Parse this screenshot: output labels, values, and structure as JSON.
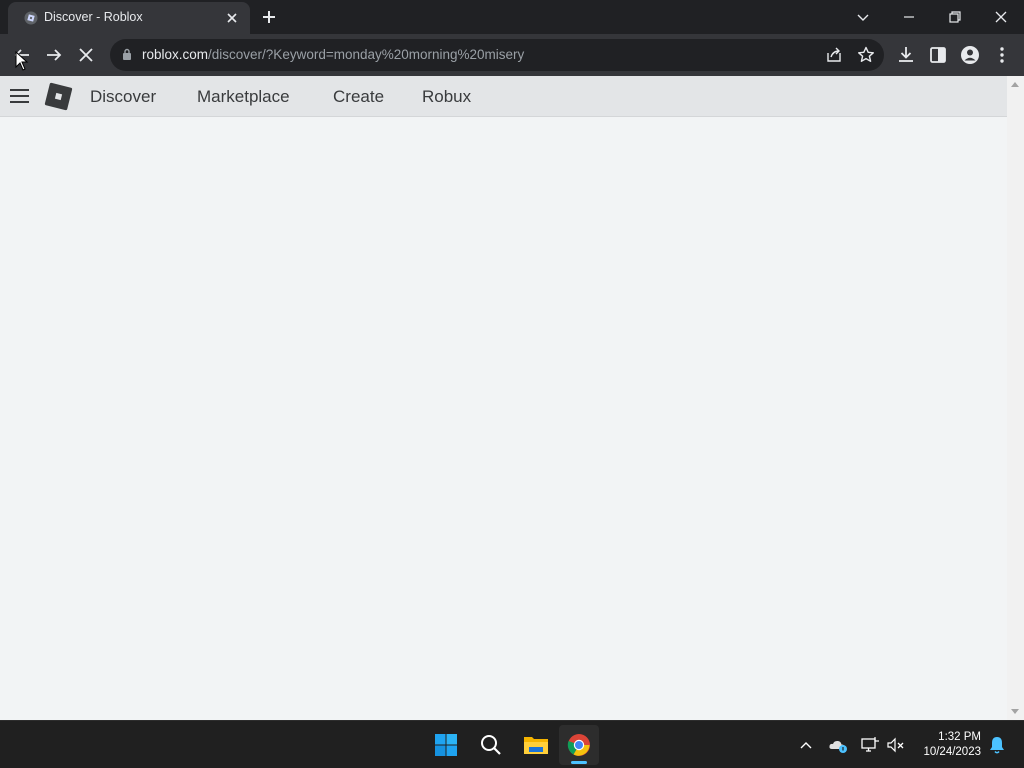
{
  "browser": {
    "tab": {
      "title": "Discover - Roblox",
      "favicon": "roblox-favicon-icon"
    },
    "omnibox": {
      "url_host": "roblox.com",
      "url_path": "/discover/?Keyword=monday%20morning%20misery"
    }
  },
  "roblox_header": {
    "nav": [
      {
        "label": "Discover"
      },
      {
        "label": "Marketplace"
      },
      {
        "label": "Create"
      },
      {
        "label": "Robux"
      }
    ]
  },
  "taskbar": {
    "apps": [
      "start-icon",
      "search-icon",
      "file-explorer-icon",
      "chrome-icon"
    ],
    "active_app": "chrome-icon",
    "time": "1:32 PM",
    "date": "10/24/2023"
  },
  "colors": {
    "titlebar": "#202124",
    "toolbar": "#35363a",
    "roblox_header": "#e3e5e7",
    "page_background": "#f2f4f5",
    "taskbar": "#202020",
    "accent": "#4cc2ff"
  }
}
